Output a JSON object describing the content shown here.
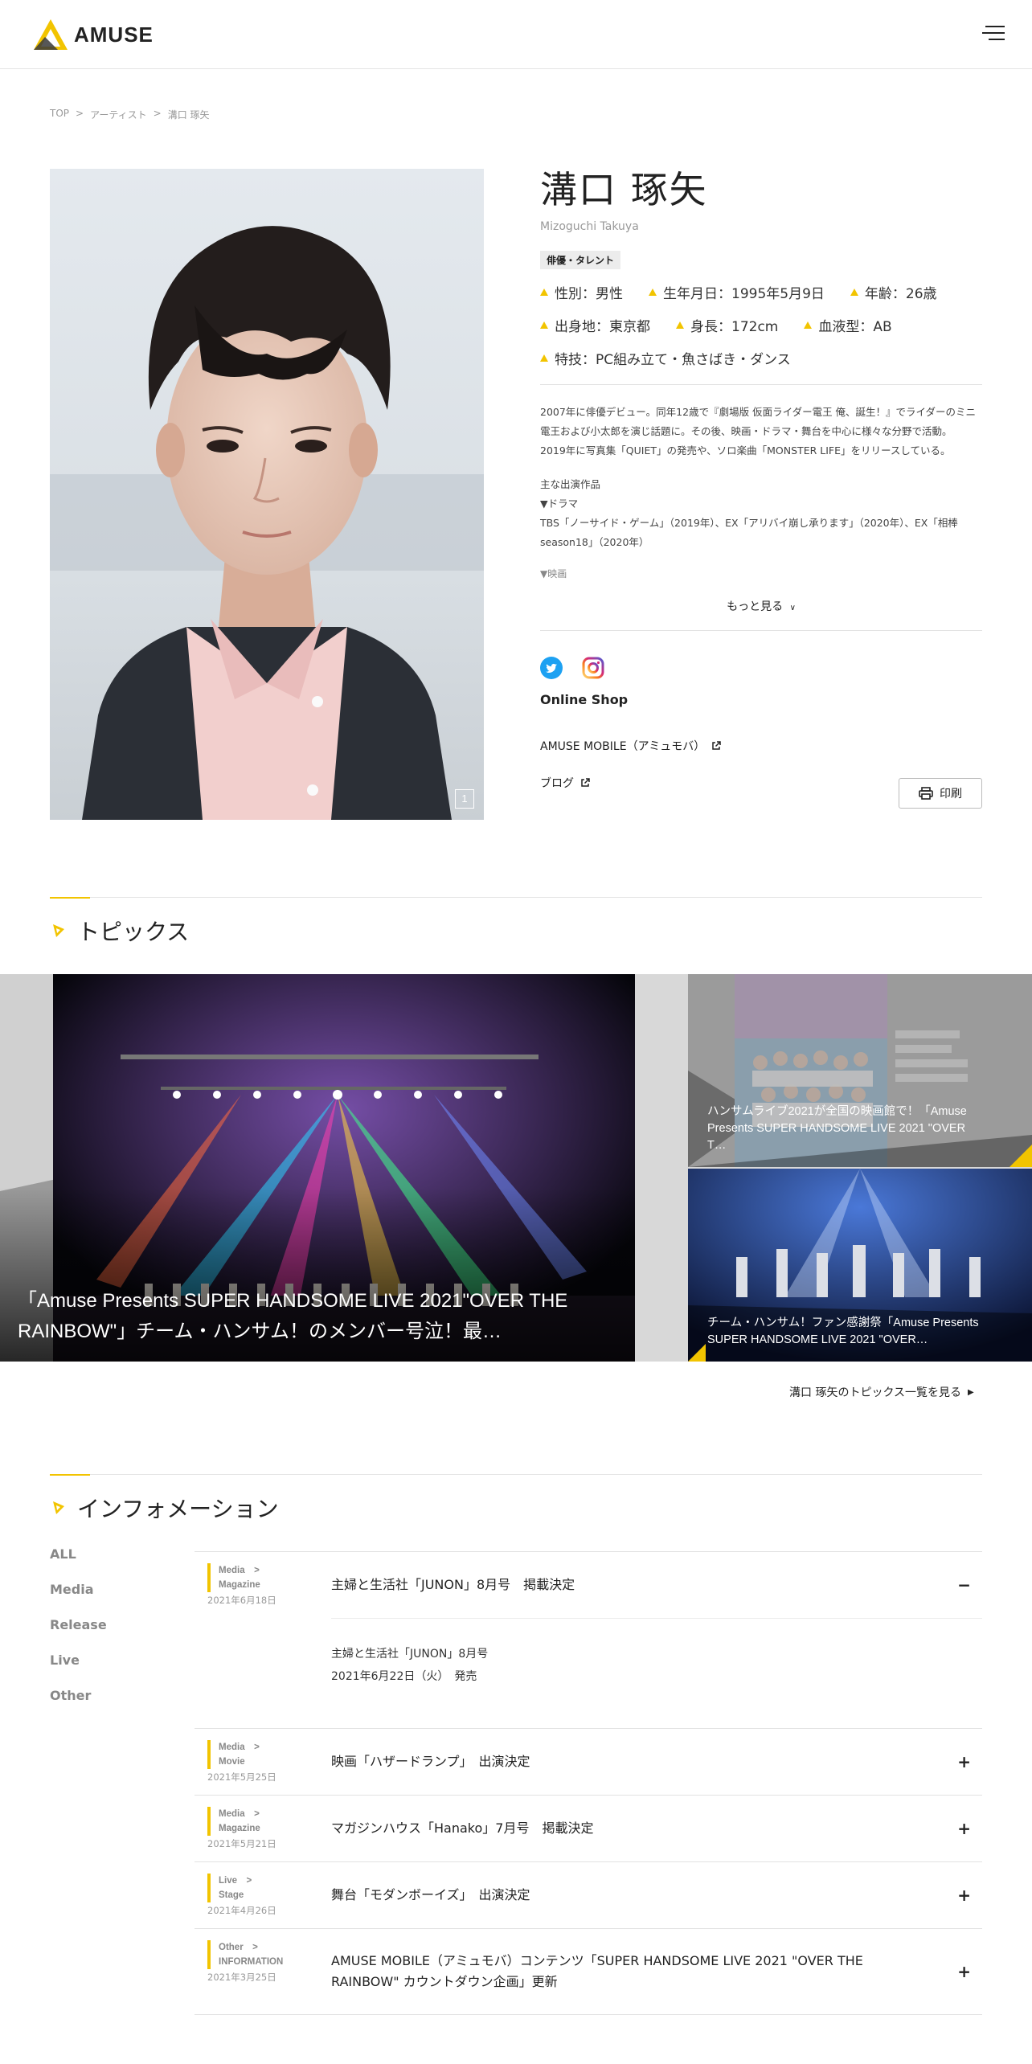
{
  "header": {
    "logo_text": "AMUSE",
    "menu_icon": "hamburger-icon"
  },
  "breadcrumb": [
    {
      "label": "TOP"
    },
    {
      "label": "アーティスト"
    },
    {
      "label": "溝口 琢矢"
    }
  ],
  "breadcrumb_sep": ">",
  "profile": {
    "name": "溝口 琢矢",
    "romaji": "Mizoguchi Takuya",
    "category": "俳優・タレント",
    "specs_row1": [
      "性別：男性",
      "生年月日：1995年5月9日",
      "年齢：26歳"
    ],
    "specs_row2": [
      "出身地：東京都",
      "身長：172cm",
      "血液型：AB"
    ],
    "specs_row3": [
      "特技：PC組み立て・魚さばき・ダンス"
    ],
    "bio_p1_line1": "2007年に俳優デビュー。同年12歳で『劇場版 仮面ライダー電王 俺、誕生！』でライダーのミニ",
    "bio_p1_line2": "電王および小太郎を演じ話題に。その後、映画・ドラマ・舞台を中心に様々な分野で活動。",
    "bio_p1_line3": "2019年に写真集「QUIET」の発売や、ソロ楽曲「MONSTER LIFE」をリリースしている。",
    "works_title": "主な出演作品",
    "works_drama_label": "▼ドラマ",
    "works_drama_line1": "TBS「ノーサイド・ゲーム」（2019年）、EX「アリバイ崩し承ります」（2020年）、EX「相棒",
    "works_drama_line2": "season18」（2020年）",
    "works_movie_label": "▼映画",
    "more_label": "もっと見る",
    "online_shop": "Online Shop",
    "mobile_link": "AMUSE MOBILE（アミュモバ）",
    "blog_link": "ブログ",
    "print_label": "印刷",
    "photo_counter": "1"
  },
  "topics": {
    "title": "トピックス",
    "main": {
      "title": "「Amuse Presents SUPER HANDSOME LIVE 2021\"OVER THE RAINBOW\"」チーム・ハンサム！のメンバー号泣！最…"
    },
    "side1": {
      "title": "ハンサムライブ2021が全国の映画館で！「Amuse Presents SUPER HANDSOME LIVE 2021 \"OVER T…"
    },
    "side2": {
      "title": "チーム・ハンサム！ファン感謝祭「Amuse Presents SUPER HANDSOME LIVE 2021 \"OVER…"
    },
    "see_all": "溝口 琢矢のトピックス一覧を見る"
  },
  "information": {
    "title": "インフォメーション",
    "filters": [
      "ALL",
      "Media",
      "Release",
      "Live",
      "Other"
    ],
    "items": [
      {
        "cat1": "Media　>",
        "cat2": "Magazine",
        "date": "2021年6月18日",
        "title": "主婦と生活社「JUNON」8月号　掲載決定",
        "toggle": "−",
        "body_line1": "主婦と生活社「JUNON」8月号",
        "body_line2": "2021年6月22日（火）　発売"
      },
      {
        "cat1": "Media　>",
        "cat2": "Movie",
        "date": "2021年5月25日",
        "title": "映画「ハザードランプ」　出演決定",
        "toggle": "+"
      },
      {
        "cat1": "Media　>",
        "cat2": "Magazine",
        "date": "2021年5月21日",
        "title": "マガジンハウス「Hanako」7月号　掲載決定",
        "toggle": "+"
      },
      {
        "cat1": "Live　>",
        "cat2": "Stage",
        "date": "2021年4月26日",
        "title": "舞台「モダンボーイズ」　出演決定",
        "toggle": "+"
      },
      {
        "cat1": "Other　>",
        "cat2": "INFORMATION",
        "date": "2021年3月25日",
        "title": "AMUSE MOBILE（アミュモバ）コンテンツ「SUPER HANDSOME LIVE 2021 \"OVER THE RAINBOW\" カウントダウン企画」更新",
        "toggle": "+"
      }
    ]
  },
  "colors": {
    "accent": "#f2c400",
    "text": "#222222",
    "muted": "#999999",
    "twitter": "#1da1f2"
  }
}
